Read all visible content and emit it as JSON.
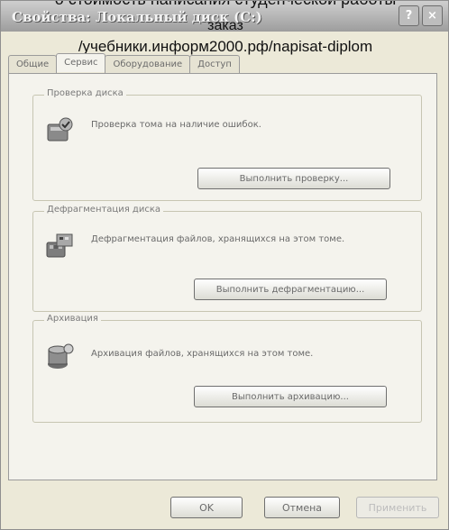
{
  "window": {
    "title": "Свойства: Локальный диск (C:)",
    "title_buttons": {
      "help": "?",
      "close": "×"
    }
  },
  "overlay": {
    "line1": "о стоимость написания студенческой работы",
    "line2": "заказ",
    "line3": "/учебники.информ2000.рф/napisat-diplom"
  },
  "tabs": [
    "Общие",
    "Сервис",
    "Оборудование",
    "Доступ"
  ],
  "active_tab": 1,
  "groups": {
    "check": {
      "title": "Проверка диска",
      "description": "Проверка тома на наличие ошибок.",
      "button": "Выполнить проверку...",
      "icon": "disk-check-icon"
    },
    "defrag": {
      "title": "Дефрагментация диска",
      "description": "Дефрагментация файлов, хранящихся на этом томе.",
      "button": "Выполнить дефрагментацию...",
      "icon": "defrag-icon"
    },
    "backup": {
      "title": "Архивация",
      "description": "Архивация файлов, хранящихся на этом томе.",
      "button": "Выполнить архивацию...",
      "icon": "backup-icon"
    }
  },
  "footer": {
    "ok": "OK",
    "cancel": "Отмена",
    "apply": "Применить"
  }
}
